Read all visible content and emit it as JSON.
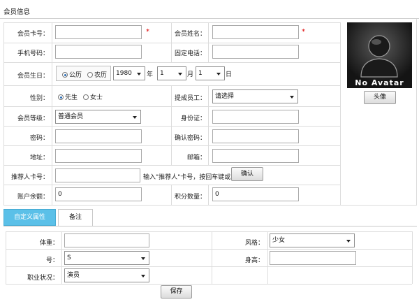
{
  "page": {
    "title": "会员信息"
  },
  "form": {
    "card_no": {
      "label": "会员卡号：",
      "value": ""
    },
    "name": {
      "label": "会员姓名：",
      "value": ""
    },
    "mobile": {
      "label": "手机号码：",
      "value": ""
    },
    "phone": {
      "label": "固定电话：",
      "value": ""
    },
    "birthday": {
      "label": "会员生日：",
      "opt_solar": "公历",
      "opt_lunar": "农历",
      "year": "1980",
      "year_unit": "年",
      "month": "1",
      "month_unit": "月",
      "day": "1",
      "day_unit": "日"
    },
    "gender": {
      "label": "性别：",
      "opt_male": "先生",
      "opt_female": "女士"
    },
    "staff": {
      "label": "提成员工：",
      "value": "请选择"
    },
    "level": {
      "label": "会员等级：",
      "value": "普通会员"
    },
    "id_card": {
      "label": "身份证：",
      "value": ""
    },
    "password": {
      "label": "密码：",
      "value": ""
    },
    "confirm_password": {
      "label": "确认密码：",
      "value": ""
    },
    "address": {
      "label": "地址：",
      "value": ""
    },
    "email": {
      "label": "邮箱：",
      "value": ""
    },
    "referrer": {
      "label": "推荐人卡号：",
      "value": "",
      "hint": "输入\"推荐人\"卡号，按回车键或",
      "confirm_label": "确认"
    },
    "balance": {
      "label": "账户余额：",
      "value": "0"
    },
    "points": {
      "label": "积分数量：",
      "value": "0"
    },
    "required_mark": "*"
  },
  "avatar": {
    "text": "No Avatar",
    "button_label": "头像"
  },
  "tabs": [
    {
      "label": "自定义属性",
      "active": true
    },
    {
      "label": "备注",
      "active": false
    }
  ],
  "custom": {
    "weight": {
      "label": "体重：",
      "value": ""
    },
    "style": {
      "label": "风格：",
      "value": "少女"
    },
    "size": {
      "label": "号：",
      "value": "S"
    },
    "height": {
      "label": "身高：",
      "value": ""
    },
    "job": {
      "label": "职业状况：",
      "value": "演员"
    }
  },
  "save_label": "保存",
  "colors": {
    "tab_active": "#5bc0e8",
    "required": "#dd0000",
    "border": "#a9a9a9"
  }
}
